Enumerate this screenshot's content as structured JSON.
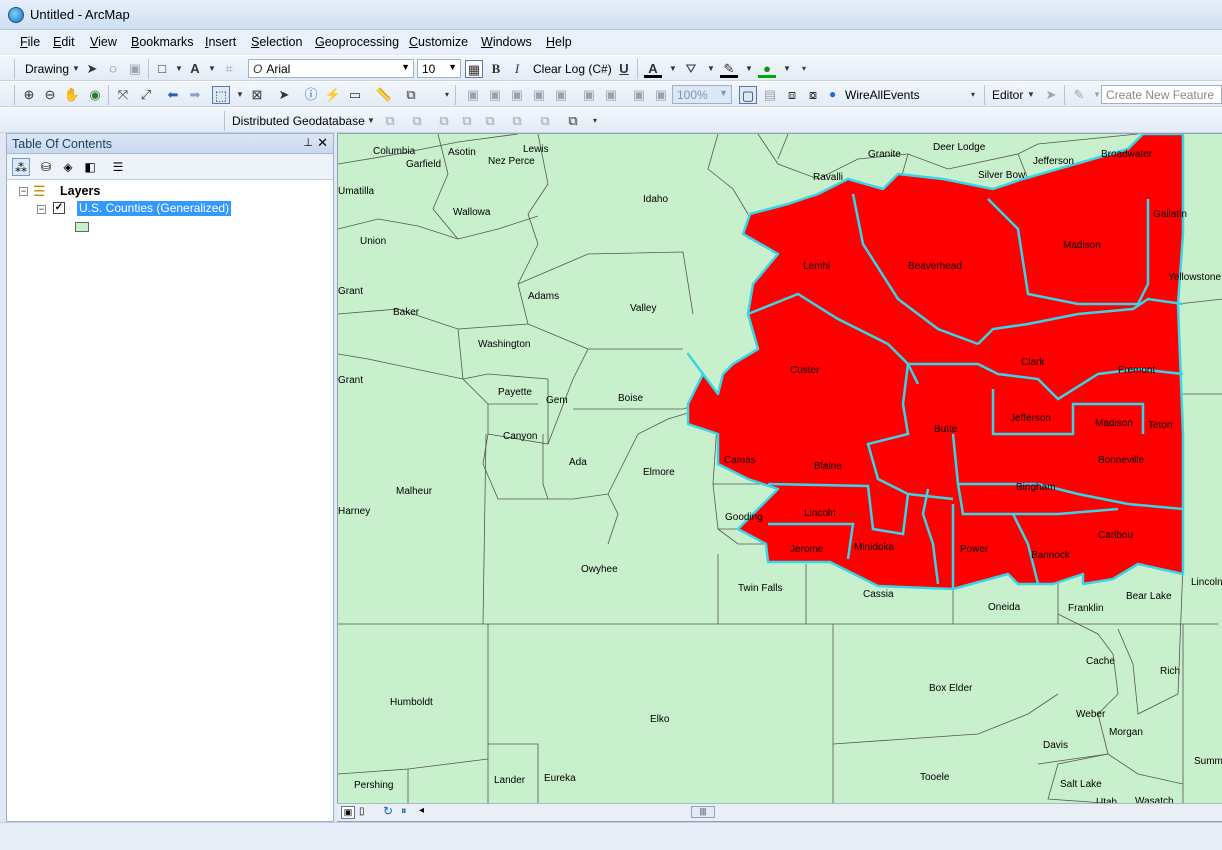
{
  "window": {
    "title": "Untitled - ArcMap"
  },
  "menu": [
    "File",
    "Edit",
    "View",
    "Bookmarks",
    "Insert",
    "Selection",
    "Geoprocessing",
    "Customize",
    "Windows",
    "Help"
  ],
  "draw_toolbar": {
    "drawing_label": "Drawing",
    "font_name": "Arial",
    "font_size": "10",
    "bold": "B",
    "italic": "I",
    "clear_log": "Clear Log (C#)",
    "underline": "U",
    "font_color_glyph": "A"
  },
  "tools_toolbar": {
    "scale": "100%",
    "wire_events": "WireAllEvents",
    "editor": "Editor",
    "create_feature": "Create New Feature"
  },
  "gdb_toolbar": {
    "label": "Distributed Geodatabase"
  },
  "toc": {
    "title": "Table Of Contents",
    "root": "Layers",
    "layer": "U.S. Counties (Generalized)",
    "checked": "✓"
  },
  "map": {
    "background_color": "#c9f0cd",
    "selected_fill": "#ff0000",
    "selection_outline": "#35d6e8",
    "county_labels": [
      "Columbia",
      "Garfield",
      "Asotin",
      "Nez Perce",
      "Lewis",
      "Granite",
      "Deer Lodge",
      "Jefferson",
      "Broadwater",
      "Ravalli",
      "Silver Bow",
      "Umatilla",
      "Idaho",
      "Gallatin",
      "Wallowa",
      "Union",
      "Lemhi",
      "Beaverhead",
      "Madison",
      "Yellowstone N",
      "Adams",
      "Grant",
      "Baker",
      "Valley",
      "Washington",
      "Custer",
      "Clark",
      "Fremont",
      "Payette",
      "Gem",
      "Boise",
      "Grant",
      "Jefferson",
      "Madison",
      "Teton",
      "Canyon",
      "Butte",
      "Ada",
      "Camas",
      "Elmore",
      "Blaine",
      "Bonneville",
      "Malheur",
      "Bingham",
      "Harney",
      "Lincoln",
      "Gooding",
      "Caribou",
      "Jerome",
      "Minidoka",
      "Power",
      "Bannock",
      "Owyhee",
      "Twin Falls",
      "Cassia",
      "Oneida",
      "Franklin",
      "Bear Lake",
      "Lincoln",
      "Cache",
      "Rich",
      "Humboldt",
      "Box Elder",
      "Elko",
      "Weber",
      "Morgan",
      "Davis",
      "Summit",
      "Pershing",
      "Lander",
      "Eureka",
      "Tooele",
      "Salt Lake",
      "Wasatch",
      "Utah"
    ]
  }
}
